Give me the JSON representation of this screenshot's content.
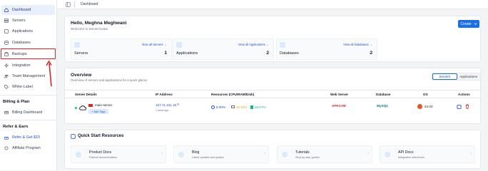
{
  "sidebar": {
    "items": [
      {
        "label": "Dashboard"
      },
      {
        "label": "Servers"
      },
      {
        "label": "Applications"
      },
      {
        "label": "Databases"
      },
      {
        "label": "Backups"
      },
      {
        "label": "Integration"
      },
      {
        "label": "Team Management"
      },
      {
        "label": "White-Label"
      }
    ],
    "billing_title": "Billing & Plan",
    "billing_dashboard": "Billing Dashboard",
    "refer_title": "Refer & Earn",
    "refer_get": "Refer & Get $10",
    "affiliate": "Affiliate Program"
  },
  "topbar": {
    "breadcrumb": "Dashboard"
  },
  "welcome": {
    "greeting": "Hello, Meghna Meghwani",
    "subtitle": "Welcome to ServerAvatar",
    "create_label": "Create",
    "stats": [
      {
        "link": "View all Servers",
        "label": "Servers",
        "value": "1"
      },
      {
        "link": "View all Applications",
        "label": "Applications",
        "value": "2"
      },
      {
        "link": "View all Databases",
        "label": "Databases",
        "value": "2"
      }
    ]
  },
  "overview": {
    "title": "Overview",
    "subtitle": "Overview of servers and applications for a quick glance",
    "tabs": [
      "Servers",
      "Applications"
    ],
    "columns": [
      "Server Details",
      "IP Address",
      "Resources (CPU/RAM/Disk)",
      "Web Server",
      "Database",
      "OS",
      "Actions"
    ],
    "row": {
      "name": "main-server",
      "add_tags": "+ Add Tags",
      "ip": "167.71.241.25",
      "ago": "1 week ago",
      "cpu": "8.00%",
      "ram": "62.83%",
      "disk": "26.07%",
      "web_server": "APACHE",
      "database": "MySQL",
      "os": "24.04"
    }
  },
  "quick": {
    "title": "Quick Start Resources",
    "items": [
      {
        "title": "Product Docs",
        "sub": "Feature documentation"
      },
      {
        "title": "Blog",
        "sub": "Latest updates and guides"
      },
      {
        "title": "Tutorials",
        "sub": "Step-by-step guides"
      },
      {
        "title": "API Docs",
        "sub": "Integration references"
      }
    ]
  },
  "colors": {
    "accent": "#1d6fe8",
    "highlight_box": "#dc2626",
    "online": "#22c55e",
    "ram": "#f59e0b",
    "disk": "#10b981"
  }
}
